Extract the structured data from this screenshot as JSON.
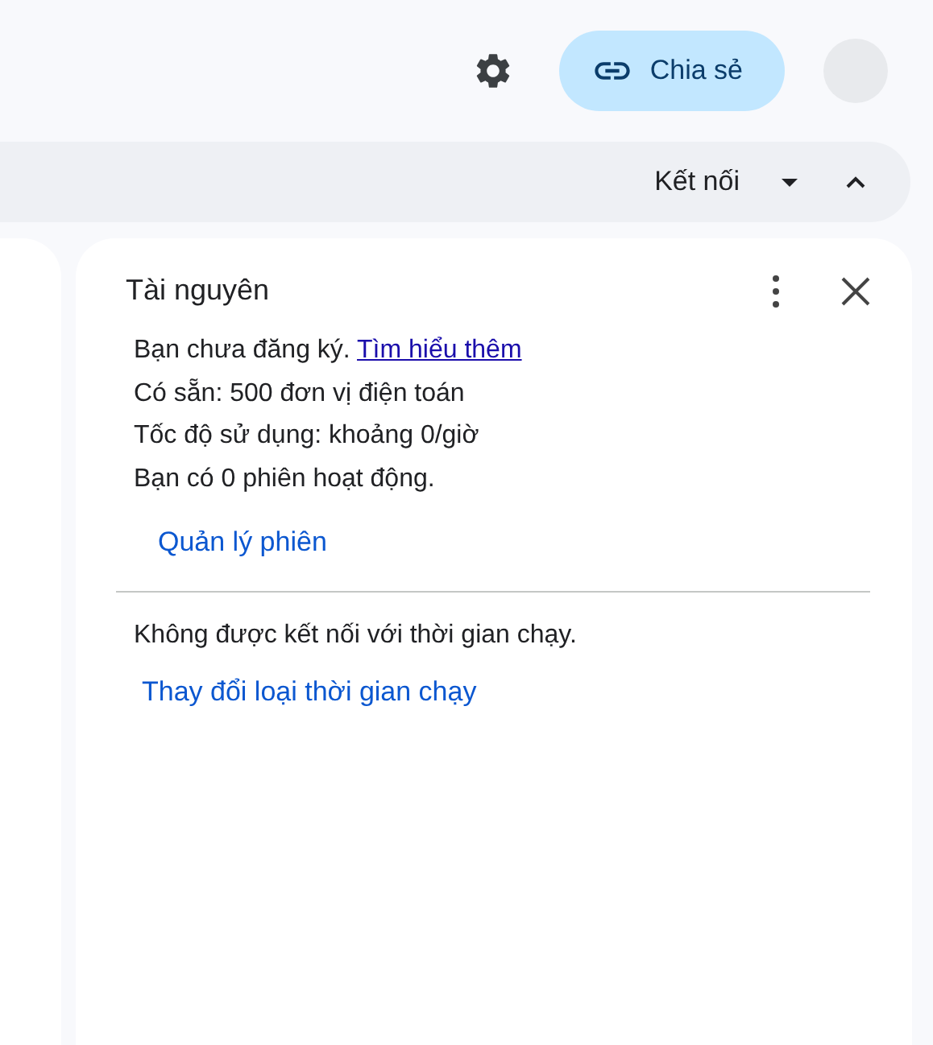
{
  "header": {
    "share_button": "Chia sẻ"
  },
  "toolbar": {
    "connect_button": "Kết nối"
  },
  "panel": {
    "title": "Tài nguyên",
    "subscription": {
      "text": "Bạn chưa đăng ký.",
      "link": "Tìm hiểu thêm"
    },
    "lines": [
      "Có sẵn: 500 đơn vị điện toán",
      "Tốc độ sử dụng: khoảng 0/giờ",
      "Bạn có 0 phiên hoạt động."
    ],
    "manage_link": "Quản lý phiên",
    "runtime_status": "Không được kết nối với thời gian chạy.",
    "change_runtime_link": "Thay đổi loại thời gian chạy"
  }
}
